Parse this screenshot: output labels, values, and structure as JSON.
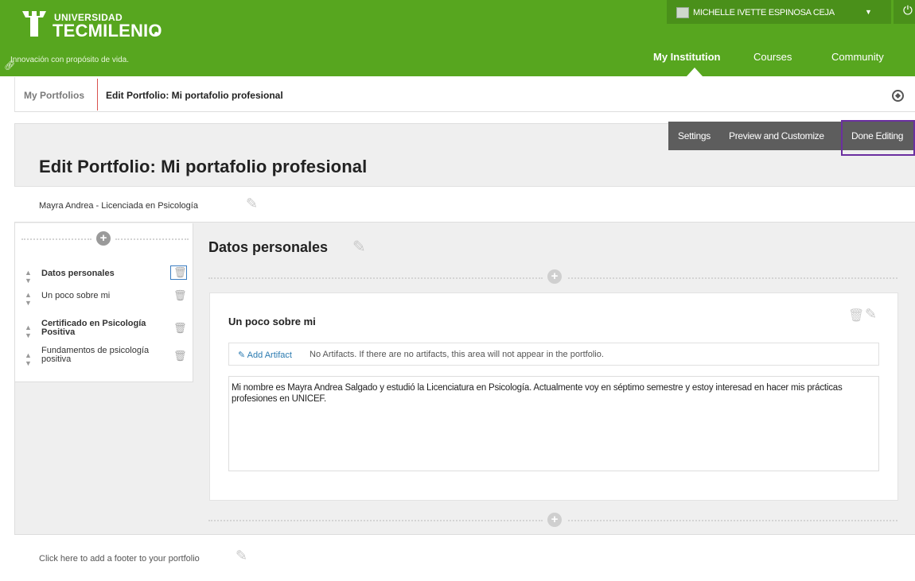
{
  "brand": {
    "university_label": "UNIVERSIDAD",
    "name": "TECMILENIO",
    "tagline": "Innovación con propósito de vida."
  },
  "user": {
    "name": "MICHELLE IVETTE ESPINOSA CEJA"
  },
  "nav": {
    "my_institution": "My Institution",
    "courses": "Courses",
    "community": "Community"
  },
  "breadcrumb": {
    "parent": "My Portfolios",
    "current": "Edit Portfolio: Mi portafolio profesional"
  },
  "actions": {
    "settings": "Settings",
    "preview": "Preview and Customize",
    "done": "Done Editing"
  },
  "page": {
    "title": "Edit Portfolio: Mi portafolio profesional",
    "header_text": "Mayra Andrea - Licenciada en Psicología",
    "footer_text": "Click here to add a footer to your portfolio"
  },
  "sidebar": {
    "items": [
      {
        "label": "Datos personales"
      },
      {
        "label": "Un poco sobre mi"
      },
      {
        "label": "Certificado en Psicología Positiva"
      },
      {
        "label": "Fundamentos de psicología positiva"
      }
    ]
  },
  "section": {
    "title": "Datos personales",
    "card_title": "Un poco sobre mi",
    "add_artifact": "Add Artifact",
    "no_artifacts_msg": "No Artifacts. If there are no artifacts, this area will not appear in the portfolio.",
    "body": "Mi nombre es Mayra Andrea Salgado y estudió la Licenciatura en Psicología. Actualmente voy en séptimo semestre y estoy interesad en hacer mis prácticas profesiones en UNICEF."
  },
  "colors": {
    "header_green": "#57a61f",
    "action_bar": "#5d5d5d",
    "highlight_purple": "#6b2fa0",
    "link_blue": "#2a7ab0"
  }
}
